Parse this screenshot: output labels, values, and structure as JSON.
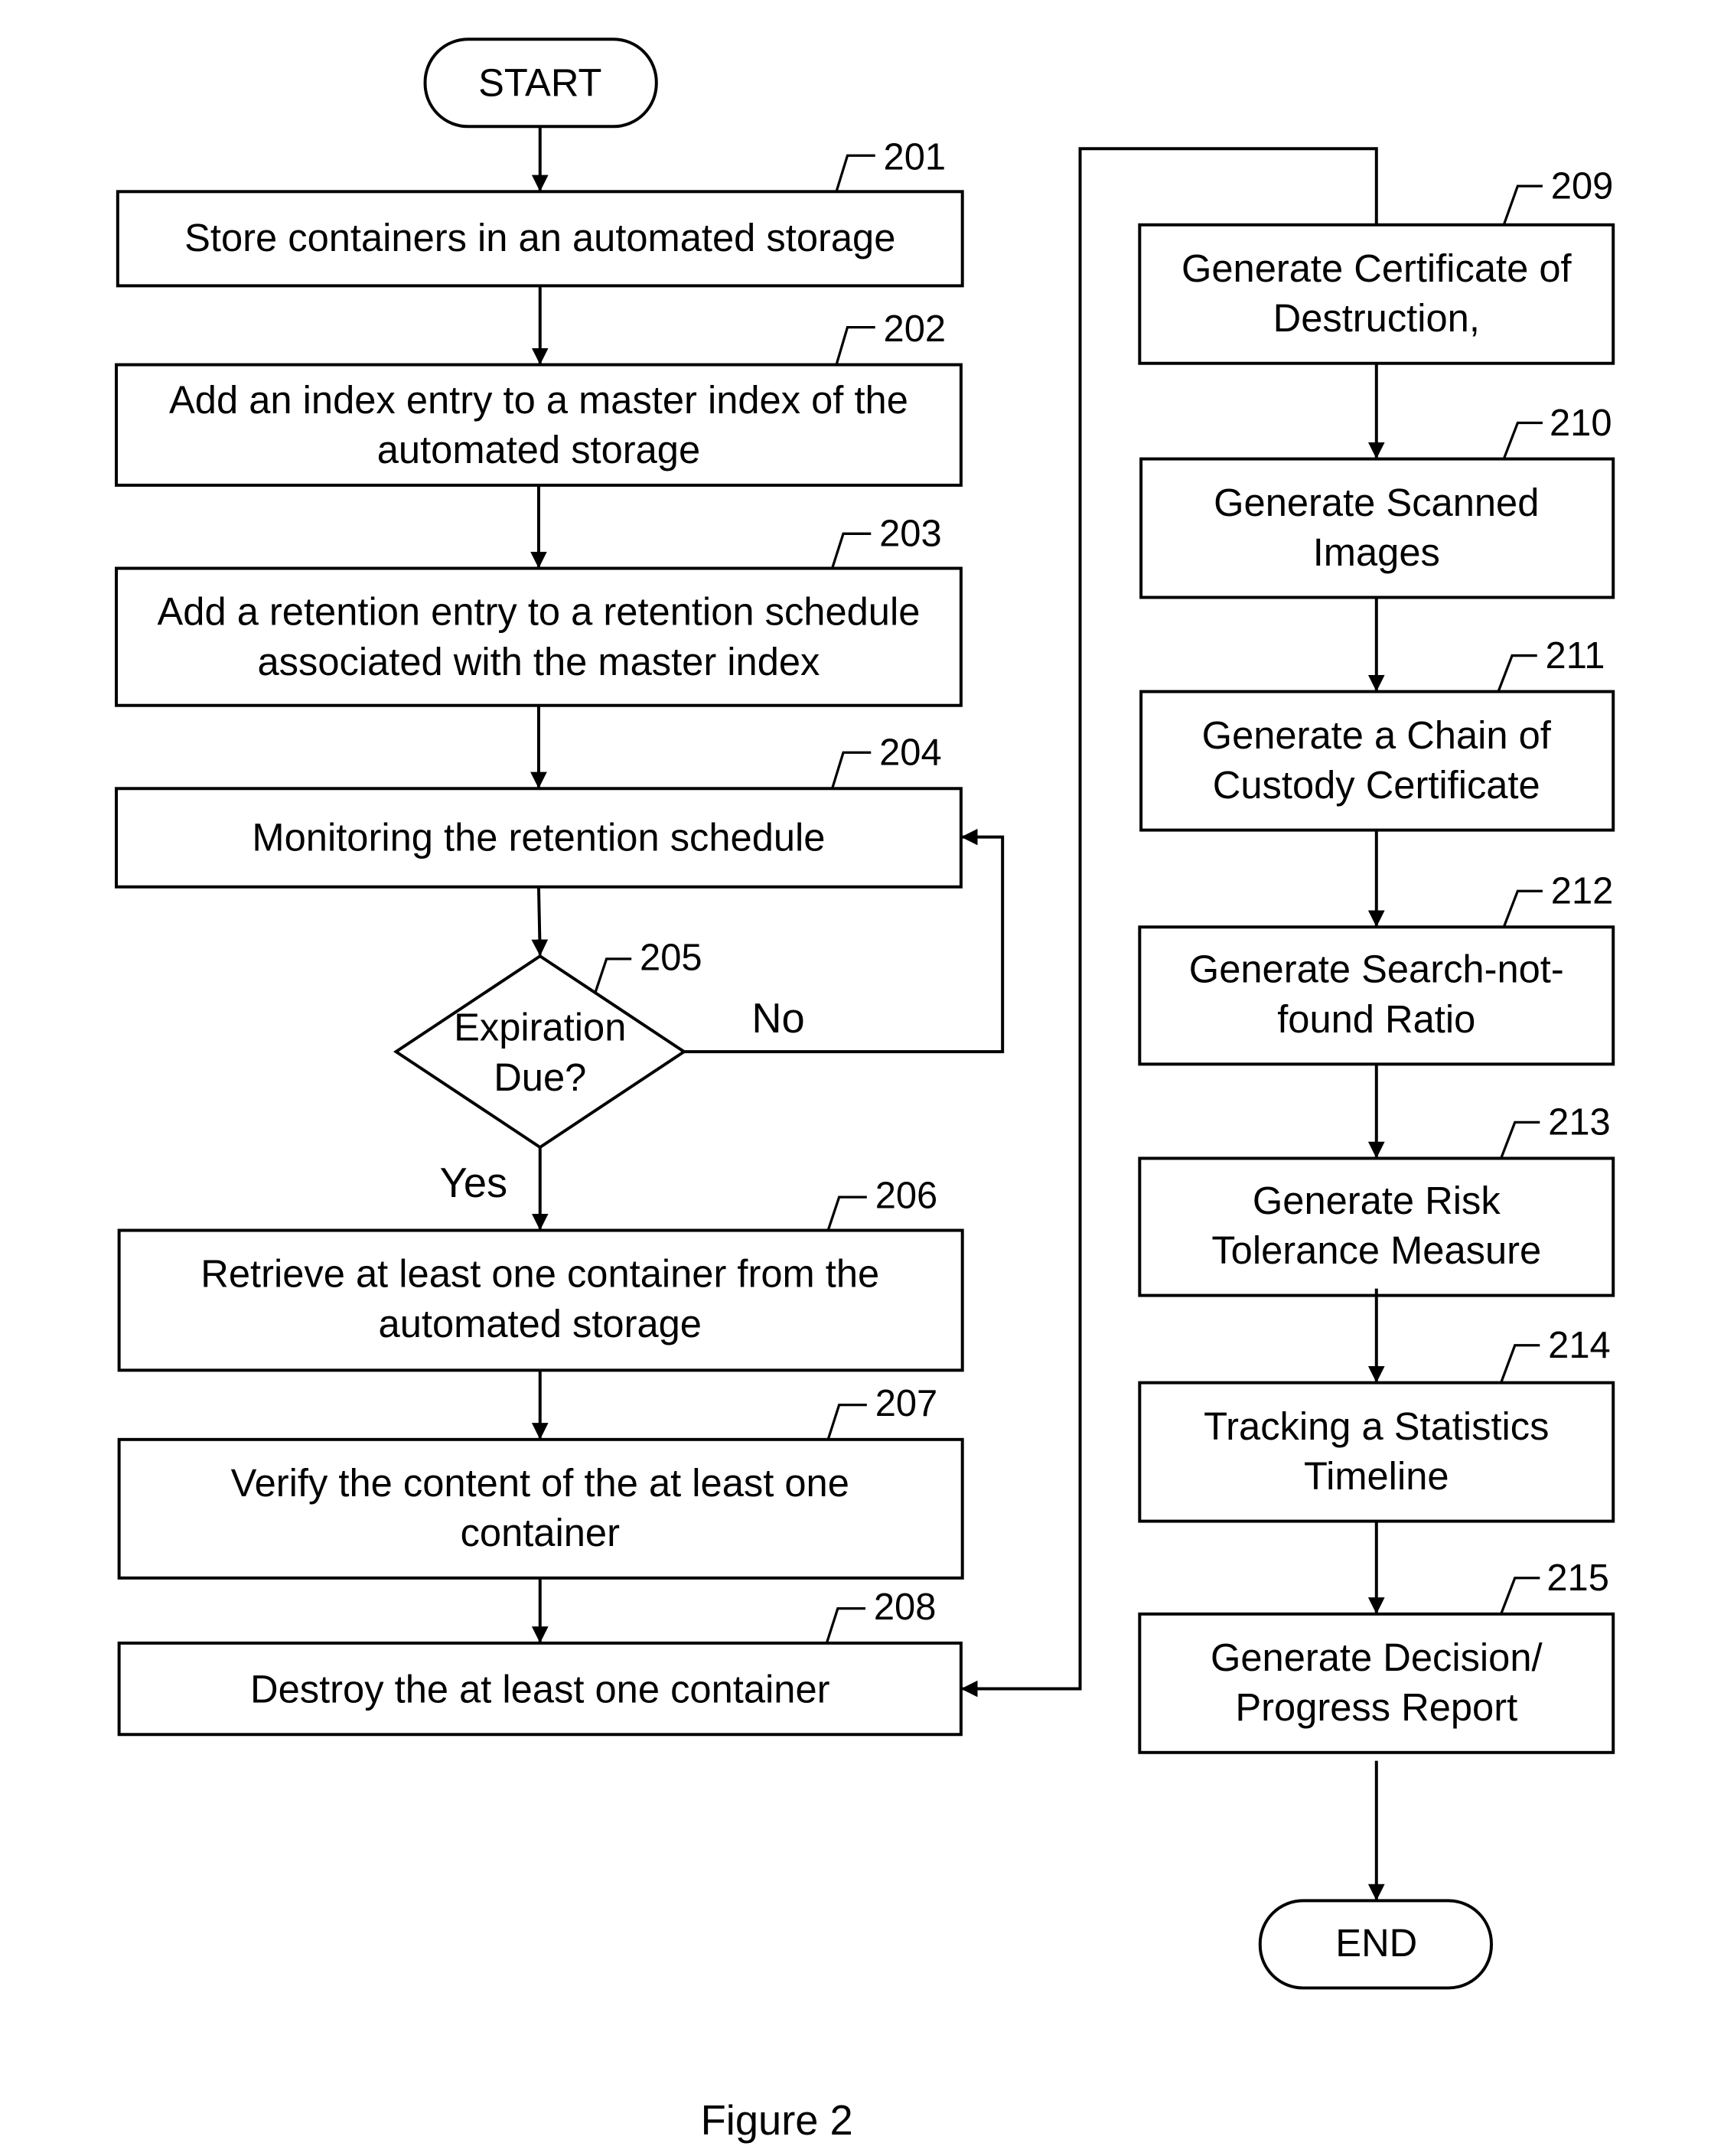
{
  "figure": {
    "caption": "Figure 2",
    "start_label": "START",
    "end_label": "END",
    "decision": {
      "ref": "205",
      "lines": [
        "Expiration",
        "Due?"
      ],
      "yes_label": "Yes",
      "no_label": "No"
    },
    "steps": [
      {
        "ref": "201",
        "lines": [
          "Store containers in an automated storage"
        ]
      },
      {
        "ref": "202",
        "lines": [
          "Add an index entry to a master index of the",
          "automated storage"
        ]
      },
      {
        "ref": "203",
        "lines": [
          "Add a retention entry to a retention schedule",
          "associated with the master index"
        ]
      },
      {
        "ref": "204",
        "lines": [
          "Monitoring the retention schedule"
        ]
      },
      {
        "ref": "206",
        "lines": [
          "Retrieve at least one container from the",
          "automated storage"
        ]
      },
      {
        "ref": "207",
        "lines": [
          "Verify the content of the at least one",
          "container"
        ]
      },
      {
        "ref": "208",
        "lines": [
          "Destroy the at least one container"
        ]
      },
      {
        "ref": "209",
        "lines": [
          "Generate Certificate of",
          "Destruction,"
        ]
      },
      {
        "ref": "210",
        "lines": [
          "Generate Scanned",
          "Images"
        ]
      },
      {
        "ref": "211",
        "lines": [
          "Generate a Chain of",
          "Custody Certificate"
        ]
      },
      {
        "ref": "212",
        "lines": [
          "Generate Search-not-",
          "found Ratio"
        ]
      },
      {
        "ref": "213",
        "lines": [
          "Generate Risk",
          "Tolerance Measure"
        ]
      },
      {
        "ref": "214",
        "lines": [
          "Tracking a Statistics",
          "Timeline"
        ]
      },
      {
        "ref": "215",
        "lines": [
          "Generate Decision/",
          "Progress Report"
        ]
      }
    ]
  }
}
